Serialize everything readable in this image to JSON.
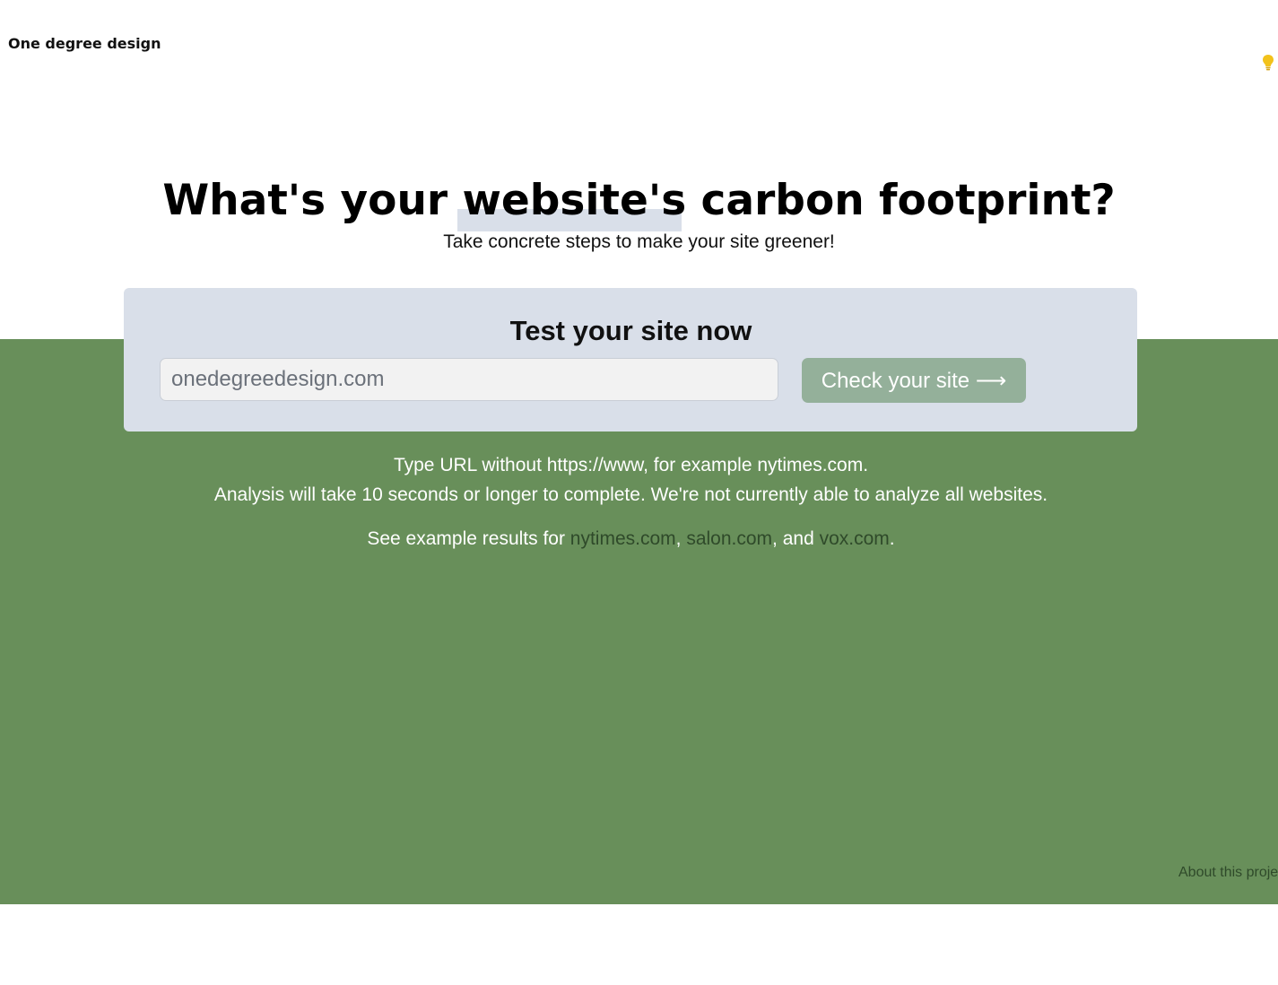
{
  "header": {
    "brand": "One degree design",
    "icon": "lightbulb-icon",
    "icon_color": "#f2c21b"
  },
  "hero": {
    "headline": "What's your website's carbon footprint?",
    "subtitle": "Take concrete steps to make your site greener!"
  },
  "test_card": {
    "title": "Test your site now",
    "input_placeholder": "onedegreedesign.com",
    "input_value": "",
    "button_label": "Check your site ⟶"
  },
  "info": {
    "line1": "Type URL without https://www, for example nytimes.com.",
    "line2": "Analysis will take 10 seconds or longer to complete. We're not currently able to analyze all websites.",
    "examples_prefix": "See example results for ",
    "example_links": [
      "nytimes.com",
      "salon.com",
      "vox.com"
    ],
    "sep1": ", ",
    "sep2": ", and ",
    "suffix": "."
  },
  "footer": {
    "about_link": "About this proje",
    "left_fragment": ")"
  },
  "colors": {
    "green_band": "#688f5a",
    "card_bg": "#d9dfe9",
    "button_bg": "#94b09a",
    "link_dark": "#2f4a2a"
  }
}
